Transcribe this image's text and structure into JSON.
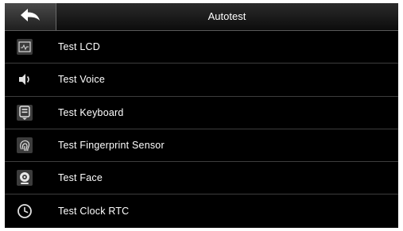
{
  "header": {
    "title": "Autotest",
    "back_icon": "back-arrow-icon"
  },
  "menu": {
    "items": [
      {
        "label": "Test LCD",
        "icon": "lcd-icon"
      },
      {
        "label": "Test Voice",
        "icon": "speaker-icon"
      },
      {
        "label": "Test Keyboard",
        "icon": "keyboard-icon"
      },
      {
        "label": "Test Fingerprint Sensor",
        "icon": "fingerprint-icon"
      },
      {
        "label": "Test Face",
        "icon": "camera-icon"
      },
      {
        "label": "Test Clock RTC",
        "icon": "clock-icon"
      }
    ]
  },
  "colors": {
    "background": "#000000",
    "text": "#ffffff",
    "divider": "#3d3d3d",
    "icon": "#d0d0d0"
  }
}
